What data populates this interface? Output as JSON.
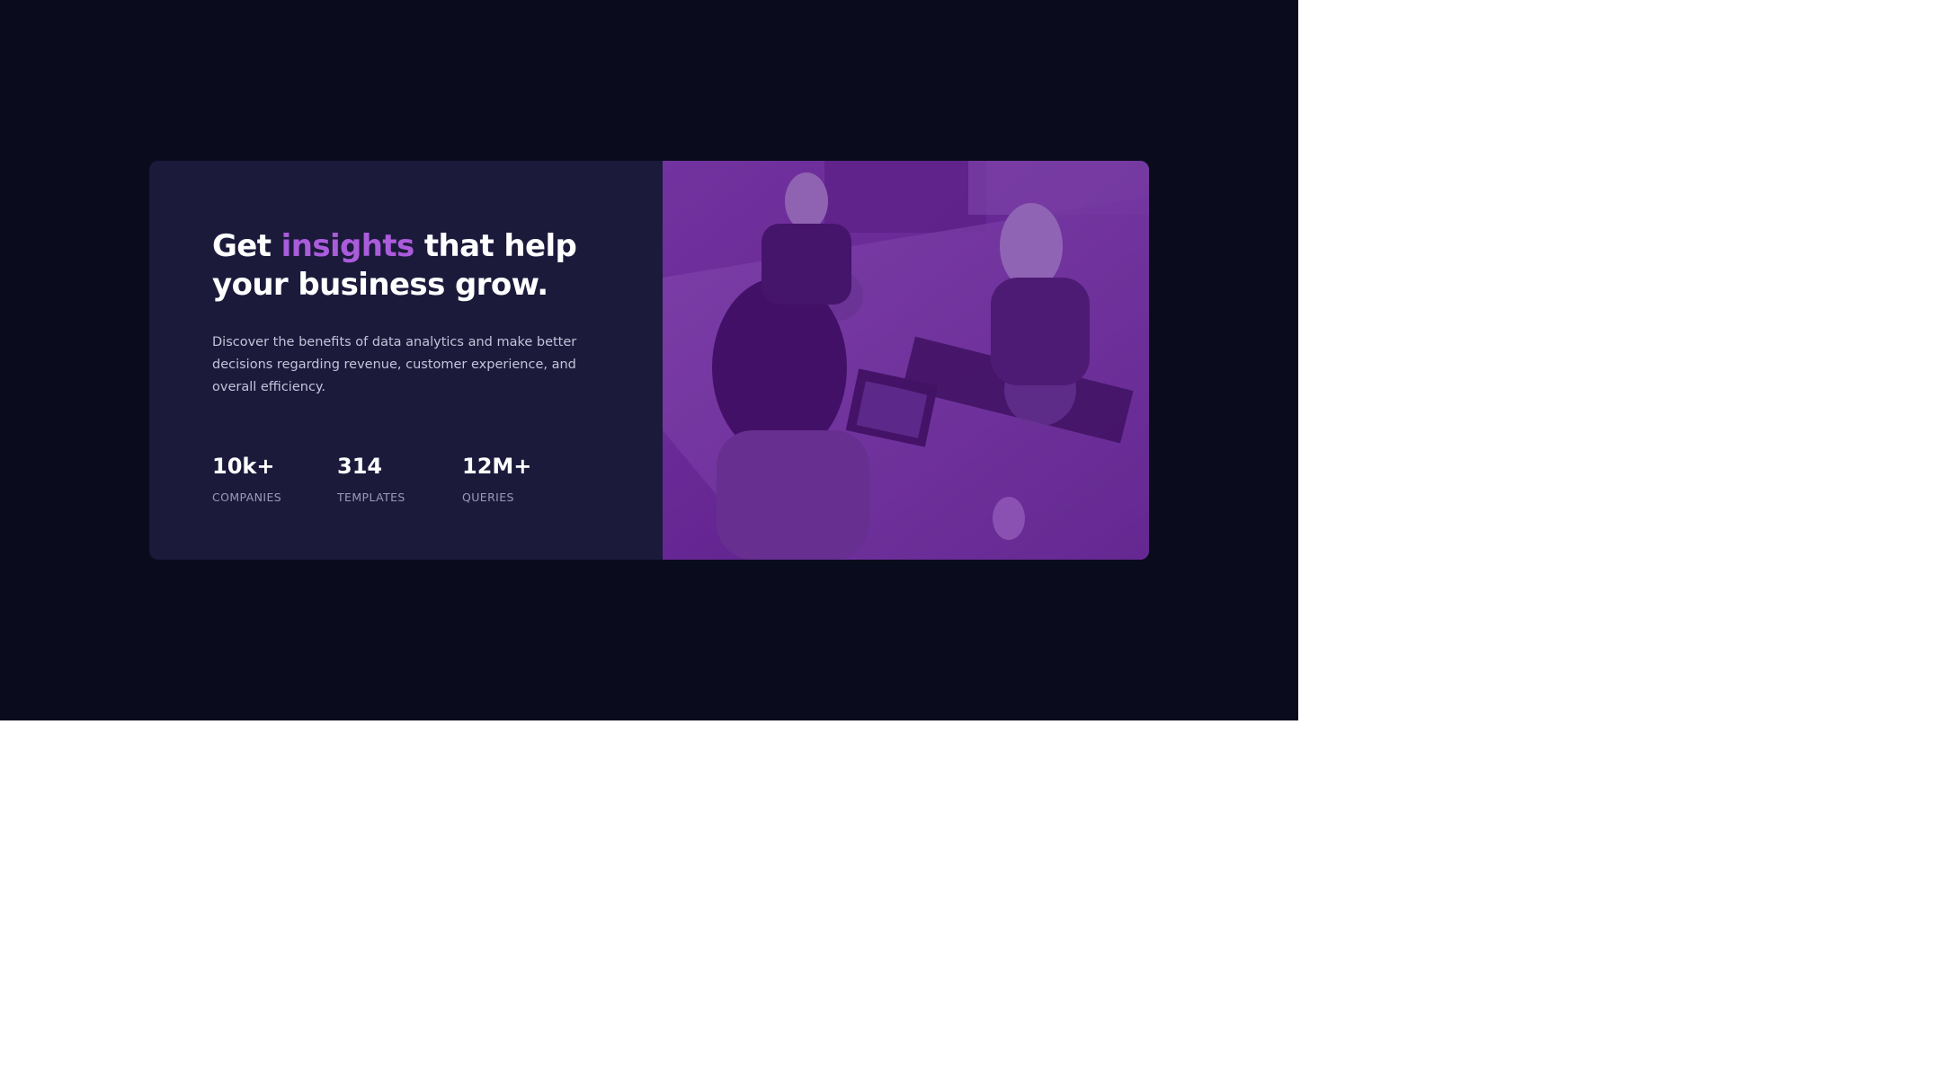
{
  "hero": {
    "headline_before": "Get ",
    "headline_accent": "insights",
    "headline_after": " that help your business grow.",
    "description": "Discover the benefits of data analytics and make better decisions regarding revenue, customer experience, and overall efficiency."
  },
  "stats": [
    {
      "value": "10k+",
      "label": "Companies"
    },
    {
      "value": "314",
      "label": "Templates"
    },
    {
      "value": "12M+",
      "label": "Queries"
    }
  ],
  "image": {
    "subject": "people working at a table with laptops"
  },
  "colors": {
    "page_background": "#0a0c1d",
    "card_background": "#1b1a3b",
    "accent": "#aa5cdb",
    "image_overlay": "#5a2186"
  }
}
